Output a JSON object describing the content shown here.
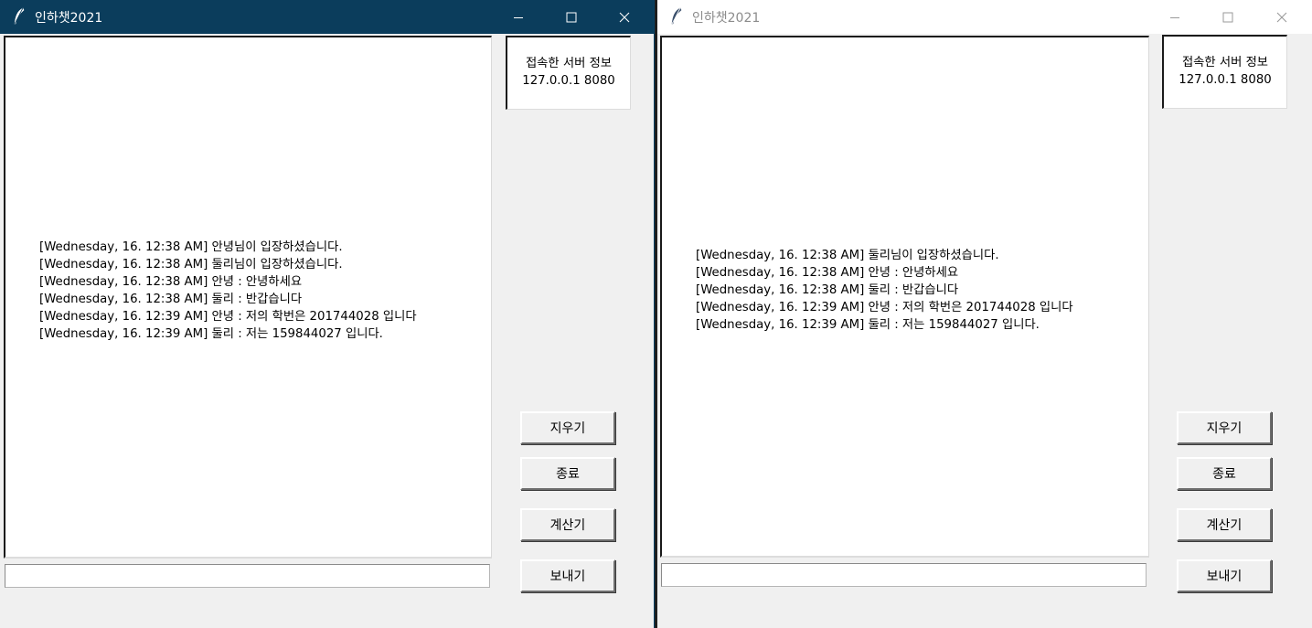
{
  "windows": [
    {
      "title": "인하챗2021",
      "server_info": {
        "heading": "접속한 서버 정보",
        "address": "127.0.0.1 8080"
      },
      "messages": [
        "[Wednesday, 16. 12:38 AM] 안녕님이 입장하셨습니다.",
        "[Wednesday, 16. 12:38 AM] 둘리님이 입장하셨습니다.",
        "[Wednesday, 16. 12:38 AM] 안녕 : 안녕하세요",
        "[Wednesday, 16. 12:38 AM] 둘리 : 반갑습니다",
        "[Wednesday, 16. 12:39 AM] 안녕 : 저의 학번은 201744028 입니다",
        "[Wednesday, 16. 12:39 AM] 둘리 : 저는 159844027 입니다."
      ],
      "input_value": "",
      "active": true
    },
    {
      "title": "인하챗2021",
      "server_info": {
        "heading": "접속한 서버 정보",
        "address": "127.0.0.1 8080"
      },
      "messages": [
        "[Wednesday, 16. 12:38 AM] 둘리님이 입장하셨습니다.",
        "[Wednesday, 16. 12:38 AM] 안녕 : 안녕하세요",
        "[Wednesday, 16. 12:38 AM] 둘리 : 반갑습니다",
        "[Wednesday, 16. 12:39 AM] 안녕 : 저의 학번은 201744028 입니다",
        "[Wednesday, 16. 12:39 AM] 둘리 : 저는 159844027 입니다."
      ],
      "input_value": "",
      "active": false
    }
  ],
  "buttons": {
    "clear": "지우기",
    "exit": "종료",
    "calc": "계산기",
    "send": "보내기"
  },
  "colors": {
    "active_titlebar": "#0b3d5c",
    "inactive_titlebar": "#ffffff",
    "window_bg": "#f0f0f0"
  },
  "icons": {
    "app": "feather-icon",
    "minimize": "minimize-icon",
    "maximize": "maximize-icon",
    "close": "close-icon"
  }
}
